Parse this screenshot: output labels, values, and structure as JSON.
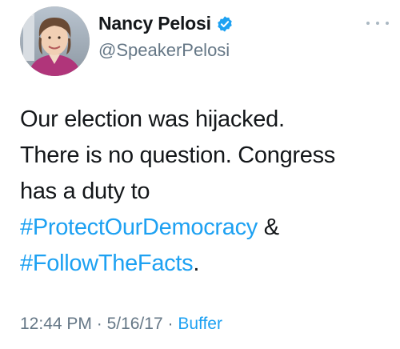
{
  "author": {
    "display_name": "Nancy Pelosi",
    "handle": "@SpeakerPelosi",
    "verified": true,
    "avatar_icon": "portrait-avatar"
  },
  "tweet": {
    "line1": "Our election was hijacked.",
    "line2": "There is no question. Congress",
    "line3": "has a duty to",
    "hashtag1": "#ProtectOurDemocracy",
    "amp": " &",
    "hashtag2": "#FollowTheFacts",
    "period": "."
  },
  "meta": {
    "time": "12:44 PM",
    "sep1": " · ",
    "date": "5/16/17",
    "sep2": " · ",
    "source": "Buffer"
  },
  "colors": {
    "link": "#1da1f2",
    "secondary_text": "#657786",
    "verified": "#1da1f2"
  },
  "icons": {
    "verified": "verified-badge-icon",
    "more": "more-options-icon"
  }
}
